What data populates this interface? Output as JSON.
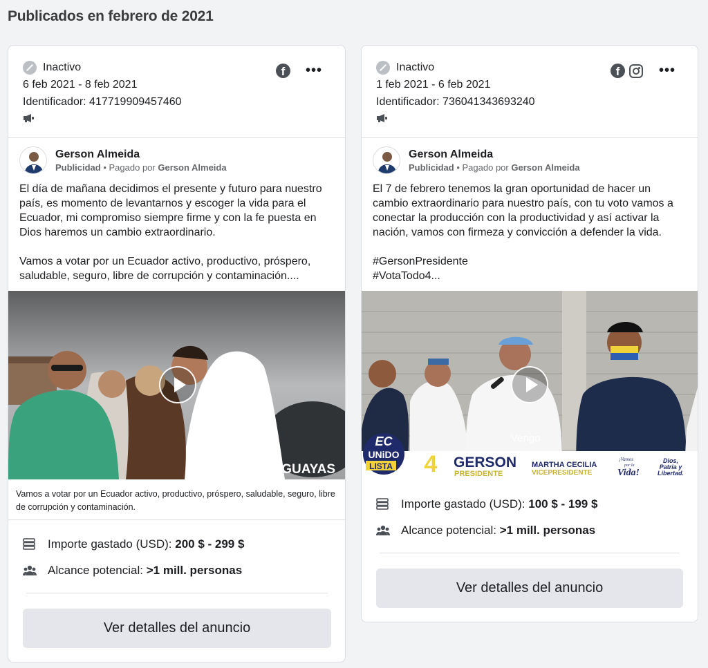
{
  "section_title": "Publicados en febrero de 2021",
  "cards": [
    {
      "status": "Inactivo",
      "dates": "6 feb 2021 - 8 feb 2021",
      "id_line": "Identificador: 417719909457460",
      "platforms": [
        "facebook-icon"
      ],
      "advertiser": "Gerson Almeida",
      "sponsored": "Publicidad",
      "paid_by_label": "Pagado por",
      "paid_by": "Gerson Almeida",
      "text": "El día de mañana decidimos el presente y futuro para nuestro país, es momento de levantarnos y escoger la vida para el Ecuador, mi compromiso siempre firme y con la fe puesta en Dios haremos un cambio extraordinario.\n\nVamos a votar por un Ecuador activo, productivo, próspero, saludable, seguro, libre de corrupción y contaminación....",
      "media_overlay": "GUAYAQUIL, GUAYAS",
      "caption": "Vamos a votar por un Ecuador activo, productivo, próspero, saludable, seguro, libre de corrupción y contaminación.",
      "spend_label": "Importe gastado (USD):",
      "spend_value": "200 $ - 299 $",
      "reach_label": "Alcance potencial:",
      "reach_value": ">1 mill. personas",
      "button": "Ver detalles del anuncio"
    },
    {
      "status": "Inactivo",
      "dates": "1 feb 2021 - 6 feb 2021",
      "id_line": "Identificador: 736041343693240",
      "platforms": [
        "facebook-icon",
        "instagram-icon"
      ],
      "advertiser": "Gerson Almeida",
      "sponsored": "Publicidad",
      "paid_by_label": "Pagado por",
      "paid_by": "Gerson Almeida",
      "text": "El 7 de febrero tenemos la gran oportunidad de hacer un cambio extraordinario para nuestro país, con tu voto vamos a conectar la producción con la productividad y así activar la nación, vamos con firmeza y convicción a defender la vida.\n\n#GersonPresidente\n#VotaTodo4...",
      "media_overlay": "Vengo",
      "banner": {
        "logo_top": "EC",
        "logo_mid": "UNiDO",
        "logo_bottom": "LISTA",
        "logo_num": "4",
        "name1": "GERSON",
        "role1": "PRESIDENTE",
        "name2": "MARTHA CECILIA",
        "role2": "VICEPRESIDENTE",
        "slogan1a": "¡Vamos",
        "slogan1b": "por la",
        "slogan1c": "Vida!",
        "slogan2a": "Dios,",
        "slogan2b": "Patria y",
        "slogan2c": "Libertad."
      },
      "spend_label": "Importe gastado (USD):",
      "spend_value": "100 $ - 199 $",
      "reach_label": "Alcance potencial:",
      "reach_value": ">1 mill. personas",
      "button": "Ver detalles del anuncio"
    }
  ]
}
